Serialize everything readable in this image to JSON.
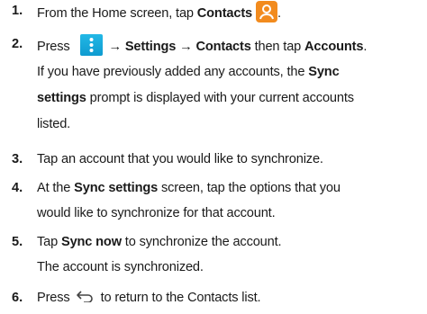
{
  "colors": {
    "contacts_icon": "#f28b1e",
    "menu_icon": "#1aaee0",
    "text": "#1a1a1a"
  },
  "icons": {
    "contacts": "contacts-person-icon",
    "menu": "menu-kebab-icon",
    "back": "back-arrow-icon"
  },
  "steps": [
    {
      "num": "1.",
      "a": "From the Home screen, tap ",
      "b1": "Contacts",
      "end": "."
    },
    {
      "num": "2.",
      "a": "Press ",
      "b1": "→ Settings → Contacts",
      "b": " then tap ",
      "b2": "Accounts",
      "end": ".",
      "l2a": "If you have previously added any accounts, the ",
      "l2b": "Sync",
      "l3a": "settings",
      "l3b": " prompt is displayed with your current accounts",
      "l4": "listed."
    },
    {
      "num": "3.",
      "a": "Tap an account that you would like to synchronize."
    },
    {
      "num": "4.",
      "a": "At the ",
      "b1": "Sync settings",
      "b": " screen, tap the options that you",
      "l2": "would like to synchronize for that account."
    },
    {
      "num": "5.",
      "a": "Tap ",
      "b1": "Sync now",
      "b": " to synchronize the account.",
      "l2": "The account is synchronized."
    },
    {
      "num": "6.",
      "a": "Press",
      "b": "to return to the Contacts list."
    }
  ]
}
